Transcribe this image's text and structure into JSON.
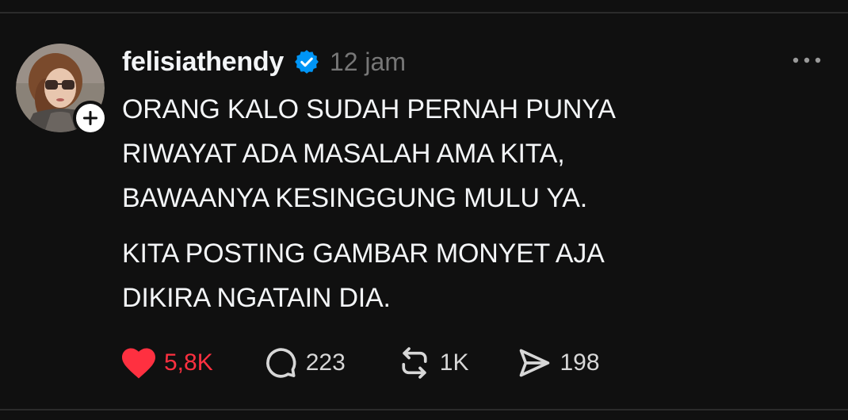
{
  "post": {
    "username": "felisiathendy",
    "timestamp": "12 jam",
    "paragraphs": [
      "ORANG KALO SUDAH PERNAH PUNYA RIWAYAT ADA MASALAH AMA KITA, BAWAANYA KESINGGUNG MULU YA.",
      "KITA POSTING GAMBAR MONYET AJA DIKIRA NGATAIN DIA."
    ],
    "paragraph_lines": [
      [
        "ORANG KALO SUDAH PERNAH PUNYA",
        "RIWAYAT ADA MASALAH AMA KITA,",
        "BAWAANYA KESINGGUNG MULU YA."
      ],
      [
        "KITA POSTING GAMBAR MONYET AJA",
        "DIKIRA NGATAIN DIA."
      ]
    ]
  },
  "actions": {
    "like_count": "5,8K",
    "reply_count": "223",
    "repost_count": "1K",
    "share_count": "198"
  },
  "icons": {
    "avatar": "avatar-photo",
    "follow": "plus-icon",
    "verified": "verified-badge-icon",
    "more": "more-horizontal-icon",
    "like": "heart-filled-icon",
    "reply": "speech-bubble-icon",
    "repost": "repost-icon",
    "share": "send-icon"
  },
  "colors": {
    "background": "#101010",
    "text": "#f3f5f7",
    "muted": "#777777",
    "like": "#ff3040",
    "verified": "#0095f6"
  }
}
